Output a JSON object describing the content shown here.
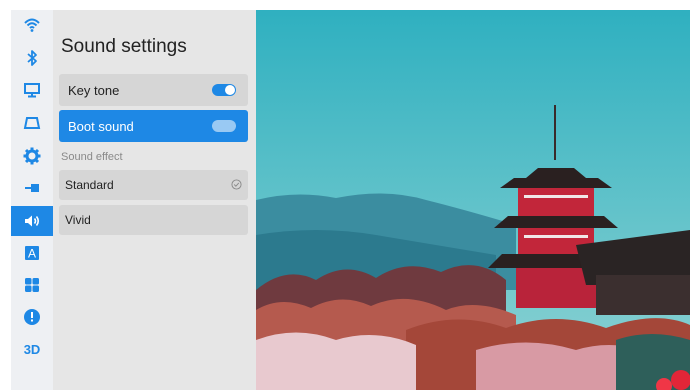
{
  "rail": {
    "items": [
      {
        "icon": "wifi-icon"
      },
      {
        "icon": "bluetooth-icon"
      },
      {
        "icon": "display-icon"
      },
      {
        "icon": "projection-icon"
      },
      {
        "icon": "gear-icon"
      },
      {
        "icon": "input-source-icon"
      },
      {
        "icon": "sound-icon",
        "active": true
      },
      {
        "icon": "language-icon",
        "text": "A"
      },
      {
        "icon": "apps-icon"
      },
      {
        "icon": "info-icon"
      },
      {
        "icon": "3d-icon",
        "text": "3D"
      }
    ]
  },
  "panel": {
    "title": "Sound settings",
    "key_tone": {
      "label": "Key tone",
      "enabled": true
    },
    "boot_sound": {
      "label": "Boot sound",
      "enabled": true
    },
    "sound_effect_label": "Sound effect",
    "options": [
      {
        "label": "Standard",
        "selected": true
      },
      {
        "label": "Vivid",
        "selected": false
      }
    ]
  },
  "colors": {
    "accent": "#1e88e5",
    "panel_bg": "#e6e6e6",
    "row_bg": "#d6d6d6",
    "sky": "#46b8c2"
  }
}
